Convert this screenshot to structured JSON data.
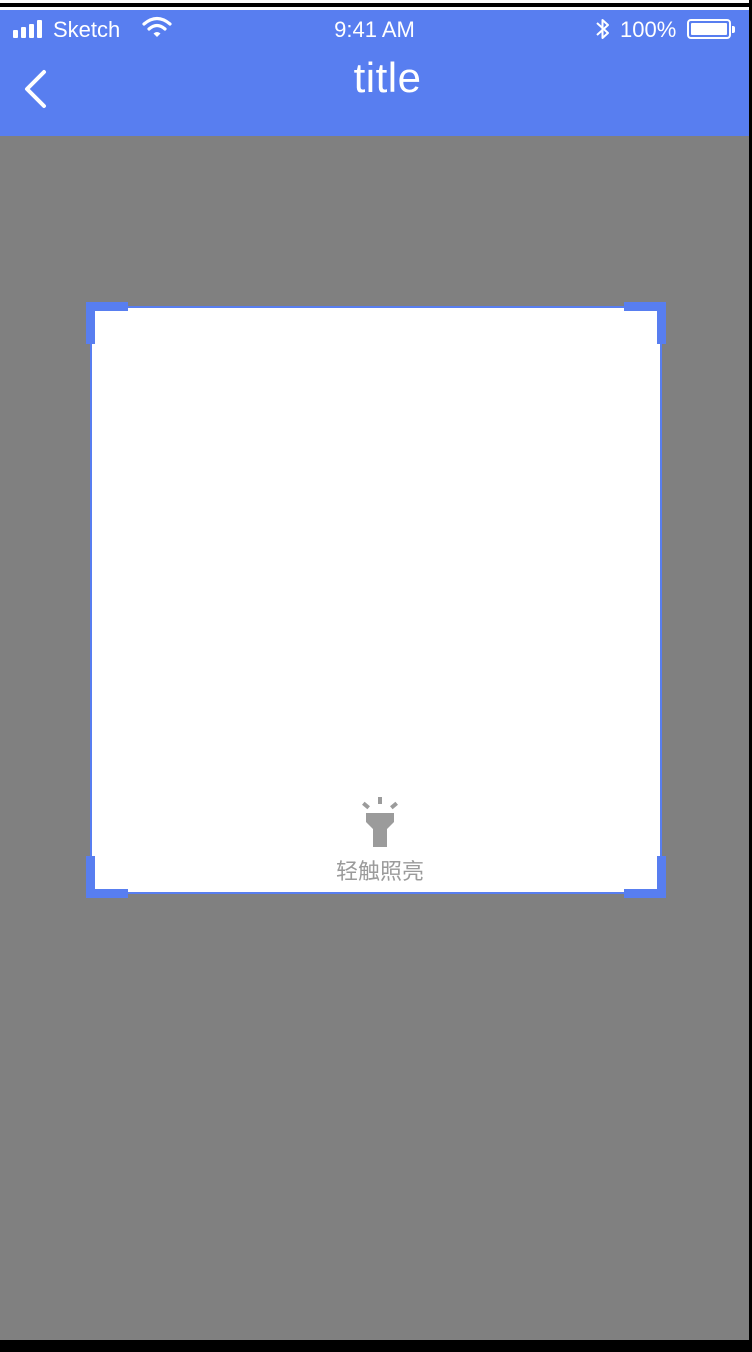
{
  "status_bar": {
    "carrier": "Sketch",
    "time": "9:41 AM",
    "battery": "100%",
    "icons": [
      "signal-icon",
      "wifi-icon",
      "bluetooth-icon",
      "battery-icon"
    ]
  },
  "nav": {
    "title": "title",
    "back_icon": "chevron-left-icon"
  },
  "scanner": {
    "torch_icon": "flashlight-icon",
    "torch_label": "轻触照亮"
  },
  "colors": {
    "accent": "#587ef0",
    "background": "#808080",
    "scan_area": "#ffffff",
    "hint_text": "#9b9b9b"
  }
}
